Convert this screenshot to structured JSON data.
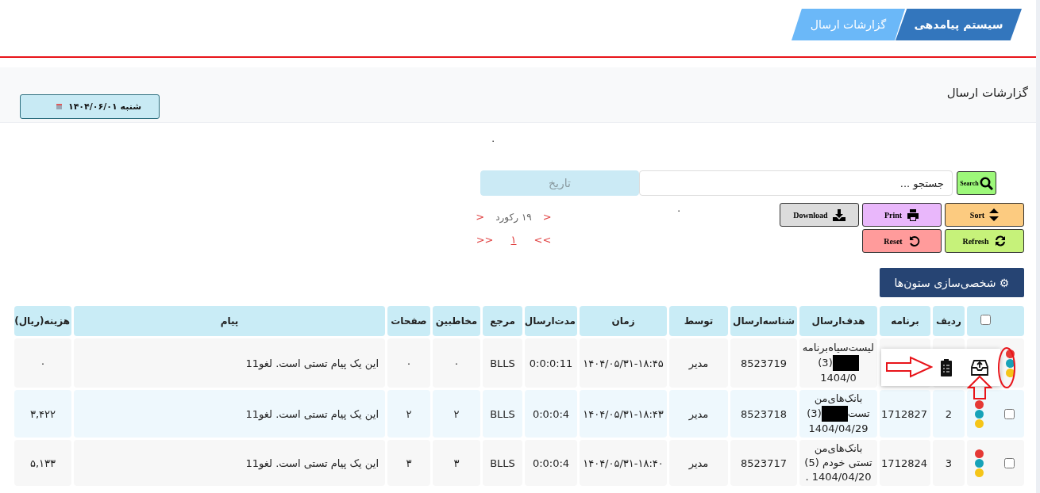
{
  "breadcrumb": [
    {
      "label": "سیستم پیامدهی"
    },
    {
      "label": "گزارشات ارسال"
    }
  ],
  "page_title": "گزارشات ارسال",
  "date_button": {
    "label": "شنبه ۱۴۰۴/۰۶/۰۱"
  },
  "stray_marks": [
    ".",
    "."
  ],
  "search": {
    "button_label": "Search",
    "placeholder": "جستجو ..."
  },
  "date_field": {
    "placeholder": "تاریخ"
  },
  "actions": [
    {
      "kind": "sort",
      "label": "Sort",
      "color": "#fccb80"
    },
    {
      "kind": "print",
      "label": "Print",
      "color": "#e9b7fb"
    },
    {
      "kind": "download",
      "label": "Download",
      "color": "#dcdcdc"
    },
    {
      "kind": "refresh",
      "label": "Refresh",
      "color": "#c6f27a"
    },
    {
      "kind": "reset",
      "label": "Reset",
      "color": "#ff9b9b"
    }
  ],
  "pagination": {
    "prev": "<",
    "records": "۱۹ رکورد",
    "next": "<",
    "first": ">>",
    "page": "۱",
    "last": "<<"
  },
  "customize_button": "⚙ شخصی‌سازی ستون‌ها",
  "table": {
    "select_all": {
      "checked": false
    },
    "columns": [
      "ردیف",
      "برنامه",
      "هدف‌ارسال",
      "شناسه‌ارسال",
      "توسط",
      "زمان",
      "مدت‌ارسال",
      "مرجع",
      "مخاطبین",
      "صفحات",
      "پیام",
      "هزینه(ریال)"
    ],
    "rows": [
      {
        "status_dots": [
          {
            "color": "#e53935"
          },
          {
            "color": "#17a2b8"
          },
          {
            "color": "#f5c518"
          }
        ],
        "target": [
          [
            {
              "kind": "text",
              "text": "لیست‌سیاه‌برنامه"
            }
          ],
          [
            {
              "kind": "redacted"
            },
            {
              "kind": "text",
              "text": "(3)"
            }
          ],
          [
            {
              "kind": "text",
              "text": "1404/0"
            }
          ]
        ],
        "send_id": "8523719",
        "by": "مدیر",
        "time": "۱۴۰۴/۰۵/۳۱-۱۸:۴۵",
        "duration": "0:0:0:11",
        "ref": "BLLS",
        "recipients": "۰",
        "pages": "۰",
        "message": "این یک پیام تستی است. لغو11",
        "cost": "۰",
        "popup": true
      },
      {
        "status_dots": [
          {
            "color": "#e53935"
          },
          {
            "color": "#17a2b8"
          },
          {
            "color": "#f5c518"
          }
        ],
        "checked": false,
        "row_no": "2",
        "program": "1712827",
        "target": [
          [
            {
              "kind": "text",
              "text": "بانک‌های‌من"
            }
          ],
          [
            {
              "kind": "text",
              "text": "تست"
            },
            {
              "kind": "redacted"
            },
            {
              "kind": "text",
              "text": "(3)"
            }
          ],
          [
            {
              "kind": "text",
              "text": "1404/04/29"
            }
          ]
        ],
        "send_id": "8523718",
        "by": "مدیر",
        "time": "۱۴۰۴/۰۵/۳۱-۱۸:۴۳",
        "duration": "0:0:0:4",
        "ref": "BLLS",
        "recipients": "۲",
        "pages": "۲",
        "message": "این یک پیام تستی است. لغو11",
        "cost": "۳,۴۲۲",
        "popup": false
      },
      {
        "status_dots": [
          {
            "color": "#e53935"
          },
          {
            "color": "#17a2b8"
          },
          {
            "color": "#f5c518"
          }
        ],
        "checked": false,
        "row_no": "3",
        "program": "1712824",
        "target": [
          [
            {
              "kind": "text",
              "text": "بانک‌های‌من"
            }
          ],
          [
            {
              "kind": "text",
              "text": "تستی خودم (5)"
            }
          ],
          [
            {
              "kind": "text",
              "text": "1404/04/20 ."
            }
          ]
        ],
        "send_id": "8523717",
        "by": "مدیر",
        "time": "۱۴۰۴/۰۵/۳۱-۱۸:۴۰",
        "duration": "0:0:0:4",
        "ref": "BLLS",
        "recipients": "۳",
        "pages": "۳",
        "message": "این یک پیام تستی است. لغو11",
        "cost": "۵,۱۳۳",
        "popup": false
      }
    ]
  }
}
